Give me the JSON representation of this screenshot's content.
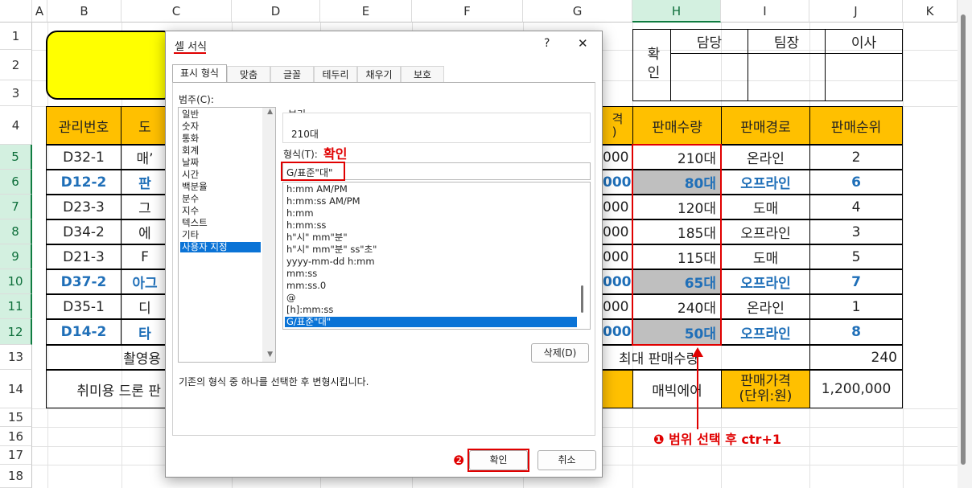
{
  "sheet": {
    "columns": [
      "A",
      "B",
      "C",
      "D",
      "E",
      "F",
      "G",
      "H",
      "I",
      "J",
      "K"
    ],
    "rows": [
      "1",
      "2",
      "3",
      "4",
      "5",
      "6",
      "7",
      "8",
      "9",
      "10",
      "11",
      "12",
      "13",
      "14",
      "15",
      "16",
      "17",
      "18"
    ],
    "approval": {
      "label": "확인",
      "headers": [
        "담당",
        "팀장",
        "이사"
      ]
    },
    "headers": {
      "b": "관리번호",
      "c": "도",
      "g_partial": "격\n)",
      "h": "판매수량",
      "i": "판매경로",
      "j": "판매순위"
    },
    "data_rows": [
      {
        "id": "D32-1",
        "name": "매’",
        "price": "000",
        "qty": "210대",
        "route": "온라인",
        "rank": "2",
        "blue": false
      },
      {
        "id": "D12-2",
        "name": "판",
        "price": "000",
        "qty": "80대",
        "route": "오프라인",
        "rank": "6",
        "blue": true
      },
      {
        "id": "D23-3",
        "name": "그",
        "price": "000",
        "qty": "120대",
        "route": "도매",
        "rank": "4",
        "blue": false
      },
      {
        "id": "D34-2",
        "name": "에",
        "price": "000",
        "qty": "185대",
        "route": "오프라인",
        "rank": "3",
        "blue": false
      },
      {
        "id": "D21-3",
        "name": "F",
        "price": "000",
        "qty": "115대",
        "route": "도매",
        "rank": "5",
        "blue": false
      },
      {
        "id": "D37-2",
        "name": "아그",
        "price": "000",
        "qty": "65대",
        "route": "오프라인",
        "rank": "7",
        "blue": true
      },
      {
        "id": "D35-1",
        "name": "디",
        "price": "000",
        "qty": "240대",
        "route": "온라인",
        "rank": "1",
        "blue": false
      },
      {
        "id": "D14-2",
        "name": "타",
        "price": "000",
        "qty": "50대",
        "route": "오프라인",
        "rank": "8",
        "blue": true
      }
    ],
    "row13": {
      "left": "촬영용",
      "mid": "최대 판매수량",
      "value": "240"
    },
    "row14": {
      "left": "취미용 드론 판",
      "name": "매빅에어",
      "price_label": "판매가격\n(단위:원)",
      "price": "1,200,000"
    }
  },
  "dialog": {
    "title": "셀 서식",
    "help": "?",
    "close": "✕",
    "tabs": [
      "표시 형식",
      "맞춤",
      "글꼴",
      "테두리",
      "채우기",
      "보호"
    ],
    "category_label": "범주(C):",
    "categories": [
      "일반",
      "숫자",
      "통화",
      "회계",
      "날짜",
      "시간",
      "백분율",
      "분수",
      "지수",
      "텍스트",
      "기타",
      "사용자 지정"
    ],
    "selected_category": "사용자 지정",
    "sample_label": "보기",
    "sample_value": "210대",
    "type_label": "형식(T):",
    "type_value": "G/표준\"대\"",
    "format_list": [
      "h:mm AM/PM",
      "h:mm:ss AM/PM",
      "h:mm",
      "h:mm:ss",
      "h\"시\" mm\"분\"",
      "h\"시\" mm\"분\" ss\"초\"",
      "yyyy-mm-dd h:mm",
      "mm:ss",
      "mm:ss.0",
      "@",
      "[h]:mm:ss",
      "G/표준\"대\""
    ],
    "delete_button": "삭제(D)",
    "description": "기존의 형식 중 하나를 선택한 후 변형시킵니다.",
    "ok_button": "확인",
    "cancel_button": "취소"
  },
  "annotations": {
    "confirm_note": "확인",
    "step1": "❶ 범위 선택 후 ctr+1",
    "step2": "❷"
  },
  "colors": {
    "orange": "#ffc000",
    "gray": "#bfbfbf",
    "blue": "#1f6fb8",
    "red": "#e00000",
    "select": "#0a73d6",
    "title_yellow": "#ffff00"
  }
}
